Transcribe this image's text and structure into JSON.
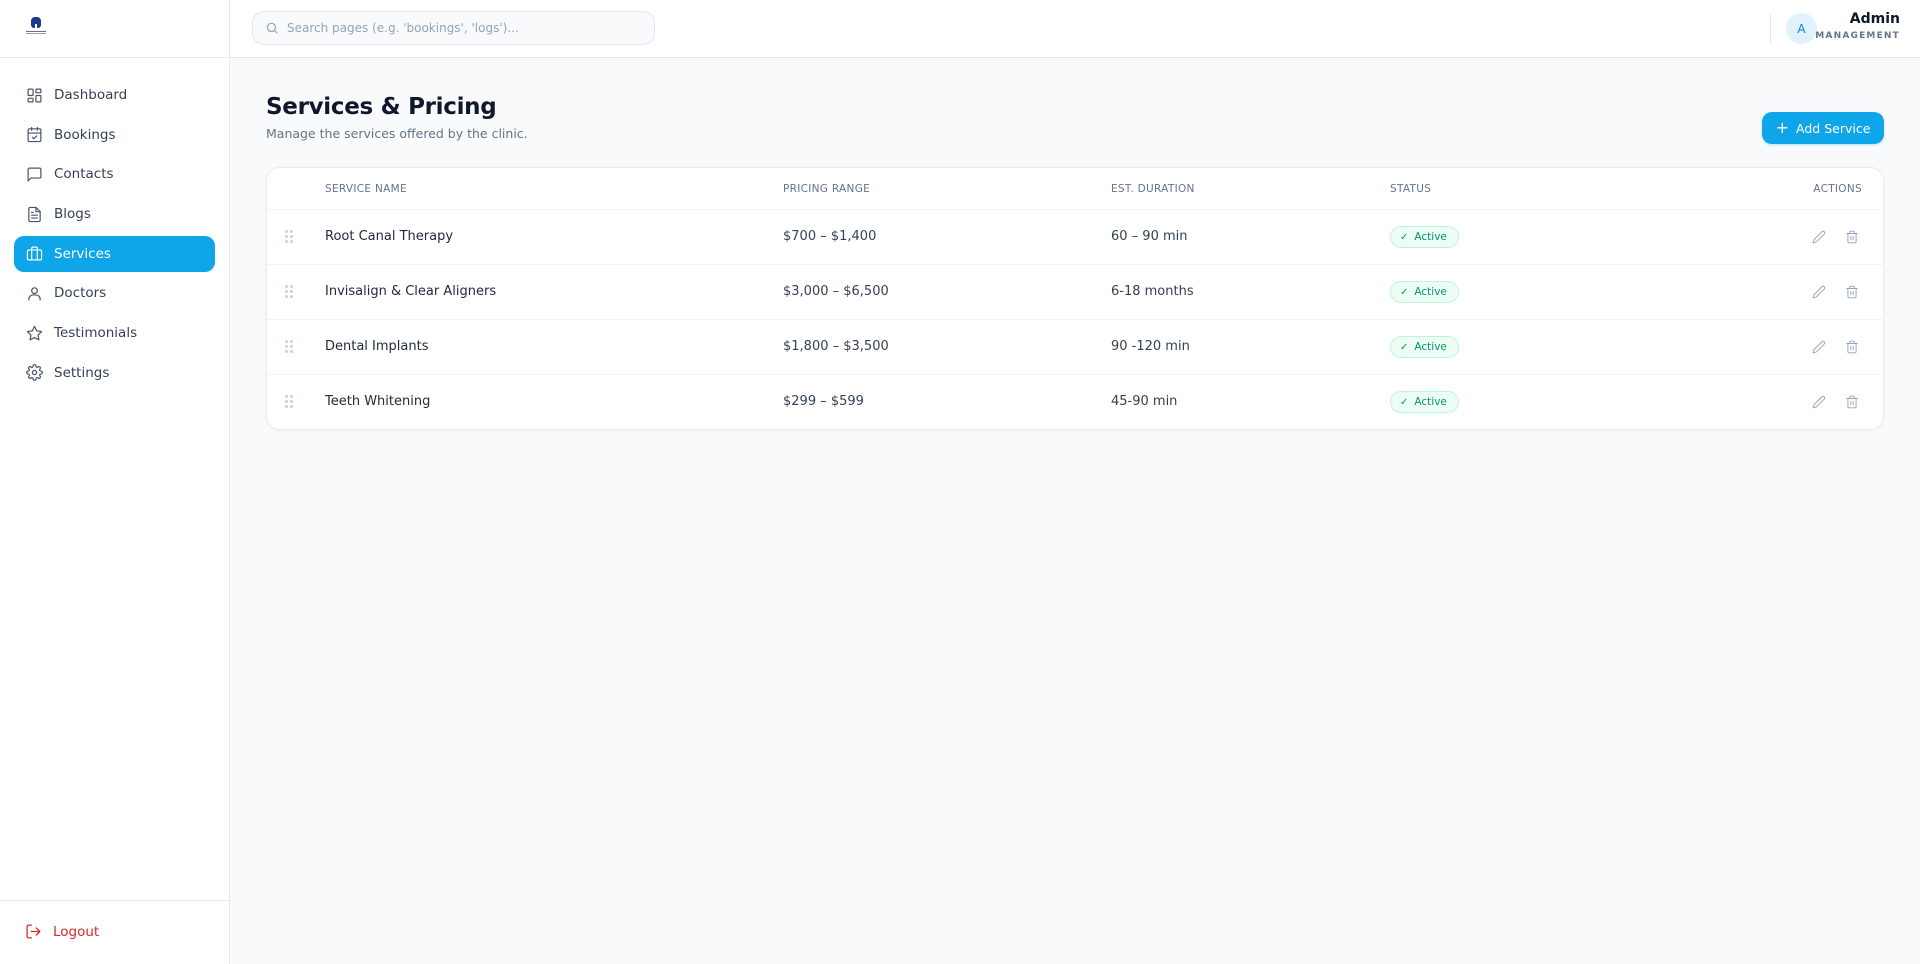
{
  "header": {
    "search_placeholder": "Search pages (e.g. 'bookings', 'logs')...",
    "avatar_initial": "A",
    "user_name": "Admin",
    "user_role": "MANAGEMENT"
  },
  "sidebar": {
    "items": [
      {
        "label": "Dashboard",
        "icon": "dashboard-icon"
      },
      {
        "label": "Bookings",
        "icon": "calendar-check-icon"
      },
      {
        "label": "Contacts",
        "icon": "message-square-icon"
      },
      {
        "label": "Blogs",
        "icon": "document-icon"
      },
      {
        "label": "Services",
        "icon": "briefcase-icon",
        "active": true
      },
      {
        "label": "Doctors",
        "icon": "user-icon"
      },
      {
        "label": "Testimonials",
        "icon": "star-icon"
      },
      {
        "label": "Settings",
        "icon": "gear-icon"
      }
    ],
    "logout_label": "Logout"
  },
  "main": {
    "title": "Services & Pricing",
    "subtitle": "Manage the services offered by the clinic.",
    "add_button_label": "Add Service",
    "table": {
      "columns": [
        "SERVICE NAME",
        "PRICING RANGE",
        "EST. DURATION",
        "STATUS",
        "ACTIONS"
      ],
      "rows": [
        {
          "name": "Root Canal Therapy",
          "price": "$700 – $1,400",
          "duration": "60 – 90 min",
          "status": "Active"
        },
        {
          "name": "Invisalign & Clear Aligners",
          "price": "$3,000 – $6,500",
          "duration": "6-18 months",
          "status": "Active"
        },
        {
          "name": "Dental Implants",
          "price": "$1,800 – $3,500",
          "duration": "90 -120 min",
          "status": "Active"
        },
        {
          "name": "Teeth Whitening",
          "price": "$299 – $599",
          "duration": "45-90 min",
          "status": "Active"
        }
      ]
    }
  },
  "colors": {
    "accent": "#0ea5e9",
    "status_active": "#059669",
    "logout": "#dc2626"
  }
}
